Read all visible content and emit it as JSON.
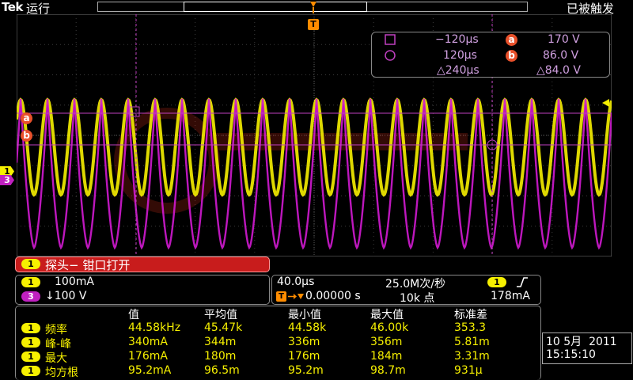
{
  "topbar": {
    "brand": "Tek",
    "run_status": "运行",
    "trigger_status": "已被触发",
    "trigger_marker": "T"
  },
  "cursor": {
    "a_time": "−120µs",
    "b_time": "120µs",
    "delta_time": "△240µs",
    "a_label": "a",
    "b_label": "b",
    "a_value": "170 V",
    "b_value": "86.0 V",
    "delta_value": "△84.0 V"
  },
  "markers": {
    "a": "a",
    "b": "b",
    "ch1": "1",
    "ch3": "3"
  },
  "probe_message": {
    "channel": "1",
    "text": "探头− 钳口打开"
  },
  "channels": {
    "ch1": {
      "num": "1",
      "scale": "100mA"
    },
    "ch3": {
      "num": "3",
      "scale": "↓100 V"
    }
  },
  "timebase": {
    "scale": "40.0µs",
    "sample_rate": "25.0M次/秒",
    "trig_pos": "0.00000 s",
    "record": "10k 点",
    "trig_channel": "1",
    "trig_level": "178mA",
    "trig_icon": "rising-edge-icon"
  },
  "measurements": {
    "headers": [
      "值",
      "平均值",
      "最小值",
      "最大值",
      "标准差"
    ],
    "rows": [
      {
        "ch": "1",
        "name": "频率",
        "values": [
          "44.58kHz",
          "45.47k",
          "44.58k",
          "46.00k",
          "353.3"
        ]
      },
      {
        "ch": "1",
        "name": "峰-峰",
        "values": [
          "340mA",
          "344m",
          "336m",
          "356m",
          "5.81m"
        ]
      },
      {
        "ch": "1",
        "name": "最大",
        "values": [
          "176mA",
          "180m",
          "176m",
          "184m",
          "3.31m"
        ]
      },
      {
        "ch": "1",
        "name": "均方根",
        "values": [
          "95.2mA",
          "96.5m",
          "95.2m",
          "98.7m",
          "931µ"
        ]
      }
    ]
  },
  "datetime": {
    "date": "10 5月  2011",
    "time": "15:15:10"
  },
  "colors": {
    "ch1": "#f6f000",
    "ch3": "#d21ad2",
    "cursor": "#c040c0",
    "trigger": "#ff8c00"
  }
}
